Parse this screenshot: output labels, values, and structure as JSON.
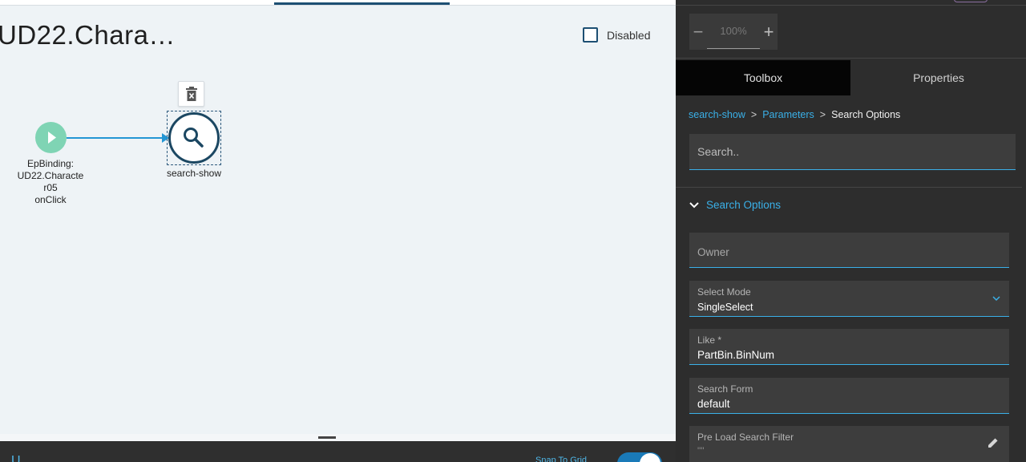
{
  "canvas": {
    "title": "UD22.Chara…",
    "disabled_label": "Disabled",
    "start_node_label": [
      "EpBinding:",
      "UD22.Characte",
      "r05",
      "onClick"
    ],
    "search_node_label": "search-show",
    "bottom_left_text": "U",
    "bottom_right_text": "Snap To Grid"
  },
  "panel": {
    "zoom": {
      "minus": "−",
      "value": "100%",
      "plus": "+"
    },
    "tabs": [
      {
        "label": "Toolbox"
      },
      {
        "label": "Properties"
      }
    ],
    "breadcrumb": {
      "items": [
        "search-show",
        "Parameters"
      ],
      "separator": ">",
      "current": "Search Options"
    },
    "search": {
      "placeholder": "Search.."
    },
    "section": {
      "title": "Search Options"
    },
    "fields": {
      "owner": {
        "label": "Owner"
      },
      "select_mode": {
        "label": "Select Mode",
        "value": "SingleSelect"
      },
      "like": {
        "label": "Like *",
        "value": "PartBin.BinNum"
      },
      "search_form": {
        "label": "Search Form",
        "value": "default"
      },
      "pre_load_filter": {
        "label": "Pre Load Search Filter",
        "value": "\"\""
      }
    }
  },
  "colors": {
    "accent": "#3ab0e8",
    "node_dark": "#1b4762",
    "start_node": "#7fd4b4",
    "panel_bg": "#2d2d2d"
  }
}
